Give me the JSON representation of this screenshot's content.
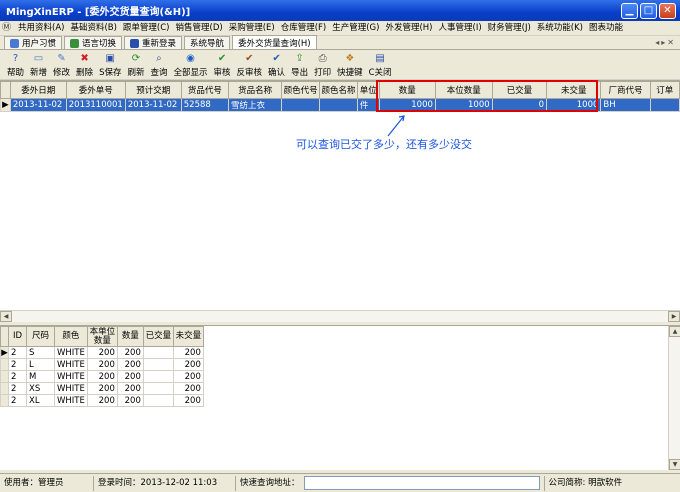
{
  "window": {
    "title": "MingXinERP - [委外交货量查询(&H)]",
    "controls": [
      "minimize",
      "maximize",
      "close"
    ]
  },
  "menubar": {
    "items": [
      "共用资料(A)",
      "基础资料(B)",
      "跟单管理(C)",
      "销售管理(D)",
      "采购管理(E)",
      "仓库管理(F)",
      "生产管理(G)",
      "外发管理(H)",
      "人事管理(I)",
      "财务管理(J)",
      "系统功能(K)",
      "图表功能"
    ]
  },
  "tabs": {
    "items": [
      {
        "label": "用户习惯",
        "icon": "user-habit-icon",
        "color": "#4a7ad0"
      },
      {
        "label": "语言切换",
        "icon": "language-icon",
        "color": "#3a8f3a"
      },
      {
        "label": "重新登录",
        "icon": "relogin-icon",
        "color": "#2a4fa8"
      },
      {
        "label": "系统导航",
        "icon": "",
        "color": ""
      },
      {
        "label": "委外交货量查询(H)",
        "icon": "",
        "color": ""
      }
    ],
    "active_index": 4
  },
  "toolbar": {
    "buttons": [
      {
        "label": "帮助",
        "icon": "help-icon",
        "glyph": "?",
        "color": "#1f5fc4"
      },
      {
        "label": "新增",
        "icon": "new-document-icon",
        "glyph": "▭",
        "color": "#4a78c8"
      },
      {
        "label": "修改",
        "icon": "edit-icon",
        "glyph": "✎",
        "color": "#4a78c8"
      },
      {
        "label": "删除",
        "icon": "delete-icon",
        "glyph": "✖",
        "color": "#d02020"
      },
      {
        "label": "S保存",
        "icon": "save-icon",
        "glyph": "▣",
        "color": "#2a4fa8"
      },
      {
        "label": "刷新",
        "icon": "refresh-icon",
        "glyph": "⟳",
        "color": "#2f8f2f"
      },
      {
        "label": "查询",
        "icon": "search-icon",
        "glyph": "⌕",
        "color": "#2a4fa8"
      },
      {
        "label": "全部显示",
        "icon": "show-all-icon",
        "glyph": "◉",
        "color": "#1f5fc4"
      },
      {
        "label": "审核",
        "icon": "approve-icon",
        "glyph": "✔",
        "color": "#2f8f2f"
      },
      {
        "label": "反审核",
        "icon": "unapprove-icon",
        "glyph": "✔",
        "color": "#a05020"
      },
      {
        "label": "确认",
        "icon": "confirm-icon",
        "glyph": "✔",
        "color": "#1f5fc4"
      },
      {
        "label": "导出",
        "icon": "export-icon",
        "glyph": "⇪",
        "color": "#2f8f2f"
      },
      {
        "label": "打印",
        "icon": "print-icon",
        "glyph": "⎙",
        "color": "#555555"
      },
      {
        "label": "快捷键",
        "icon": "shortcut-icon",
        "glyph": "❖",
        "color": "#c08020"
      },
      {
        "label": "C关闭",
        "icon": "close-doc-icon",
        "glyph": "▤",
        "color": "#2a4fa8"
      }
    ]
  },
  "main_grid": {
    "columns": [
      "委外日期",
      "委外单号",
      "预计交期",
      "货品代号",
      "货品名称",
      "颜色代号",
      "颜色名称",
      "单位",
      "数量",
      "本位数量",
      "已交量",
      "未交量",
      "厂商代号",
      "订单"
    ],
    "rows": [
      [
        "2013-11-02",
        "2013110001",
        "2013-11-02",
        "52588",
        "雪纺上衣",
        "",
        "",
        "件",
        "1000",
        "1000",
        "0",
        "1000",
        "BH",
        ""
      ]
    ]
  },
  "annotation": {
    "text": "可以查询已交了多少，还有多少没交",
    "color": "#1a55e0",
    "box_color": "#e00000"
  },
  "detail_grid": {
    "columns": [
      "ID",
      "尺码",
      "颜色",
      "本单位数量",
      "数量",
      "已交量",
      "未交量"
    ],
    "rows": [
      [
        "2",
        "S",
        "WHITE",
        "200",
        "200",
        "",
        "200"
      ],
      [
        "2",
        "L",
        "WHITE",
        "200",
        "200",
        "",
        "200"
      ],
      [
        "2",
        "M",
        "WHITE",
        "200",
        "200",
        "",
        "200"
      ],
      [
        "2",
        "XS",
        "WHITE",
        "200",
        "200",
        "",
        "200"
      ],
      [
        "2",
        "XL",
        "WHITE",
        "200",
        "200",
        "",
        "200"
      ]
    ]
  },
  "statusbar": {
    "user": "使用者：管理员",
    "login_time": "登录时间：2013-12-02 11:03",
    "query_label": "快速查询地址：",
    "query_value": "",
    "company": "公司简称: 明歆软件"
  }
}
